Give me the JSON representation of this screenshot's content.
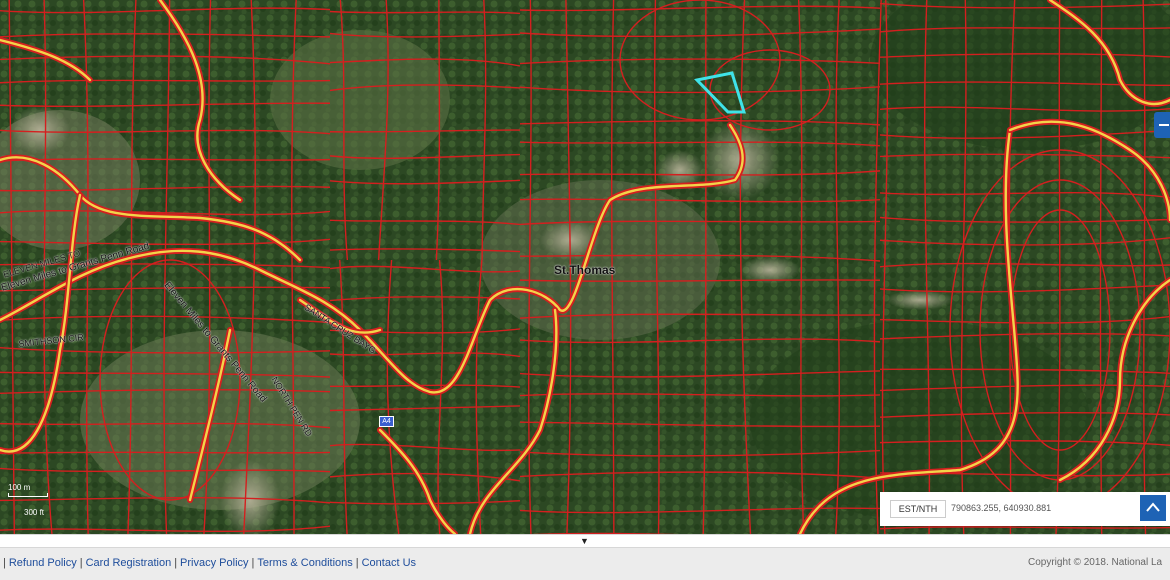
{
  "map": {
    "town_label": "St.Thomas",
    "road_labels": {
      "sandy": "SANTA CRUZ BAYG",
      "smith": "SMITHSON CIR",
      "eleven1": "Eleven Miles to Grants Penn Road",
      "eleven2": "Eleven Miles to Grants Penn Road",
      "eleven3": "ELEVEN MILES TO",
      "eleven4": "NORTH PEN RD"
    },
    "route_shield": "A4",
    "scale_top": "100 m",
    "scale_bottom": "300 ft",
    "colors": {
      "parcel_line": "#d41f1f",
      "road_line": "#f2d44a",
      "selected_parcel": "#3fe3e8",
      "vegetation": "#2f4a25",
      "accent": "#1e63b5"
    }
  },
  "controls": {
    "zoom_icon": "minus-icon",
    "coord_icon": "chevron-up-icon",
    "collapse_icon": "triangle-down-icon"
  },
  "coordinates": {
    "label": "EST/NTH",
    "value": "790863.255, 640930.881"
  },
  "divider": {
    "arrow": "▼"
  },
  "footer": {
    "links": [
      "Refund Policy",
      "Card Registration",
      "Privacy Policy",
      "Terms & Conditions",
      "Contact Us"
    ],
    "copyright": "Copyright © 2018. National La"
  }
}
